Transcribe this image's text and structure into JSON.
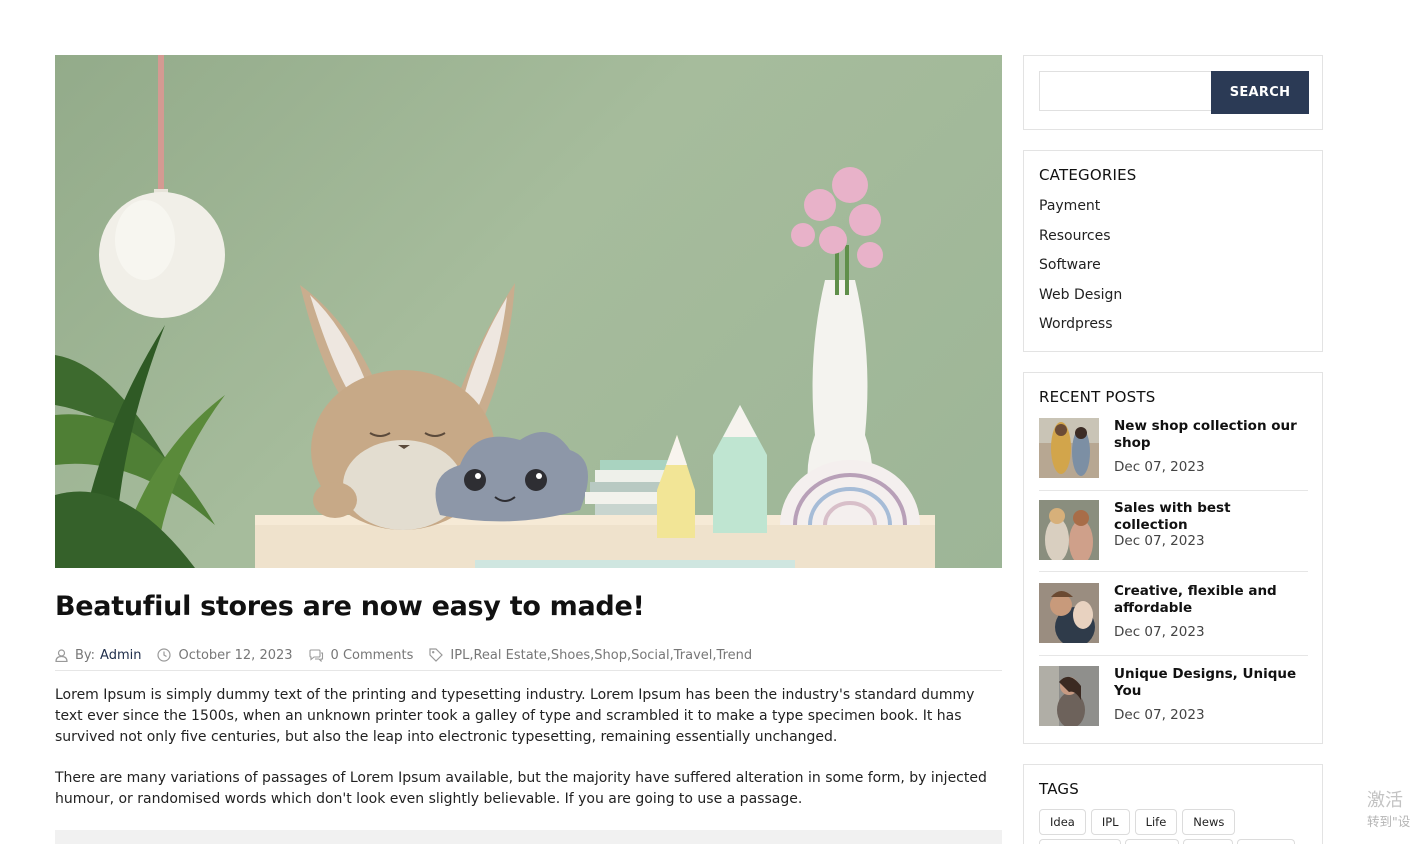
{
  "post": {
    "title": "Beatufiul stores are now easy to made!",
    "meta": {
      "by_label": "By:",
      "author": "Admin",
      "date": "October 12, 2023",
      "comments": "0 Comments",
      "tags": "IPL,Real Estate,Shoes,Shop,Social,Travel,Trend"
    },
    "paragraphs": [
      "Lorem Ipsum is simply dummy text of the printing and typesetting industry. Lorem Ipsum has been the industry's standard dummy text ever since the 1500s, when an unknown printer took a galley of type and scrambled it to make a type specimen book. It has survived not only five centuries, but also the leap into electronic typesetting, remaining essentially unchanged.",
      "There are many variations of passages of Lorem Ipsum available, but the majority have suffered alteration in some form, by injected humour, or randomised words which don't look even slightly believable. If you are going to use a passage."
    ]
  },
  "sidebar": {
    "search": {
      "button_label": "SEARCH",
      "value": ""
    },
    "categories": {
      "title": "CATEGORIES",
      "items": [
        "Payment",
        "Resources",
        "Software",
        "Web Design",
        "Wordpress"
      ]
    },
    "recent_posts": {
      "title": "RECENT POSTS",
      "items": [
        {
          "title": "New shop collection our shop",
          "date": "Dec 07, 2023"
        },
        {
          "title": "Sales with best collection",
          "date": "Dec 07, 2023"
        },
        {
          "title": "Creative, flexible and affordable",
          "date": "Dec 07, 2023"
        },
        {
          "title": "Unique Designs, Unique You",
          "date": "Dec 07, 2023"
        }
      ]
    },
    "tags": {
      "title": "TAGS",
      "items": [
        "Idea",
        "IPL",
        "Life",
        "News"
      ]
    }
  },
  "watermark": {
    "line1": "激活",
    "line2": "转到\"设"
  },
  "colors": {
    "accent": "#2b3a55",
    "hero_wall": "#9db597"
  }
}
